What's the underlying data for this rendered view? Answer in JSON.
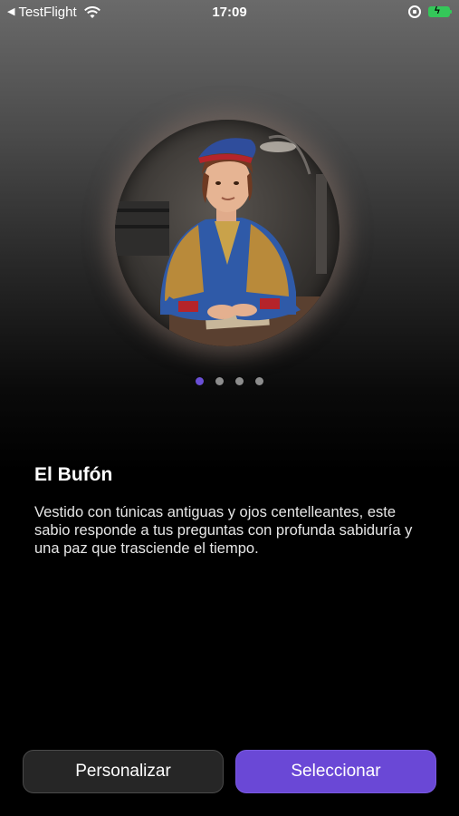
{
  "status_bar": {
    "back_app": "TestFlight",
    "time": "17:09",
    "icons": [
      "back-arrow-icon",
      "wifi-icon",
      "orientation-lock-icon",
      "battery-charging-icon"
    ],
    "battery_color": "#34c759"
  },
  "character": {
    "name": "El Bufón",
    "description": "Vestido con túnicas antiguas y ojos centelleantes, este sabio responde a tus preguntas con profunda sabiduría y una paz que trasciende el tiempo."
  },
  "pager": {
    "total": 4,
    "active_index": 0,
    "active_color": "#6a4fd6"
  },
  "buttons": {
    "personalizar": "Personalizar",
    "seleccionar": "Seleccionar"
  },
  "colors": {
    "accent": "#6a48d6"
  }
}
